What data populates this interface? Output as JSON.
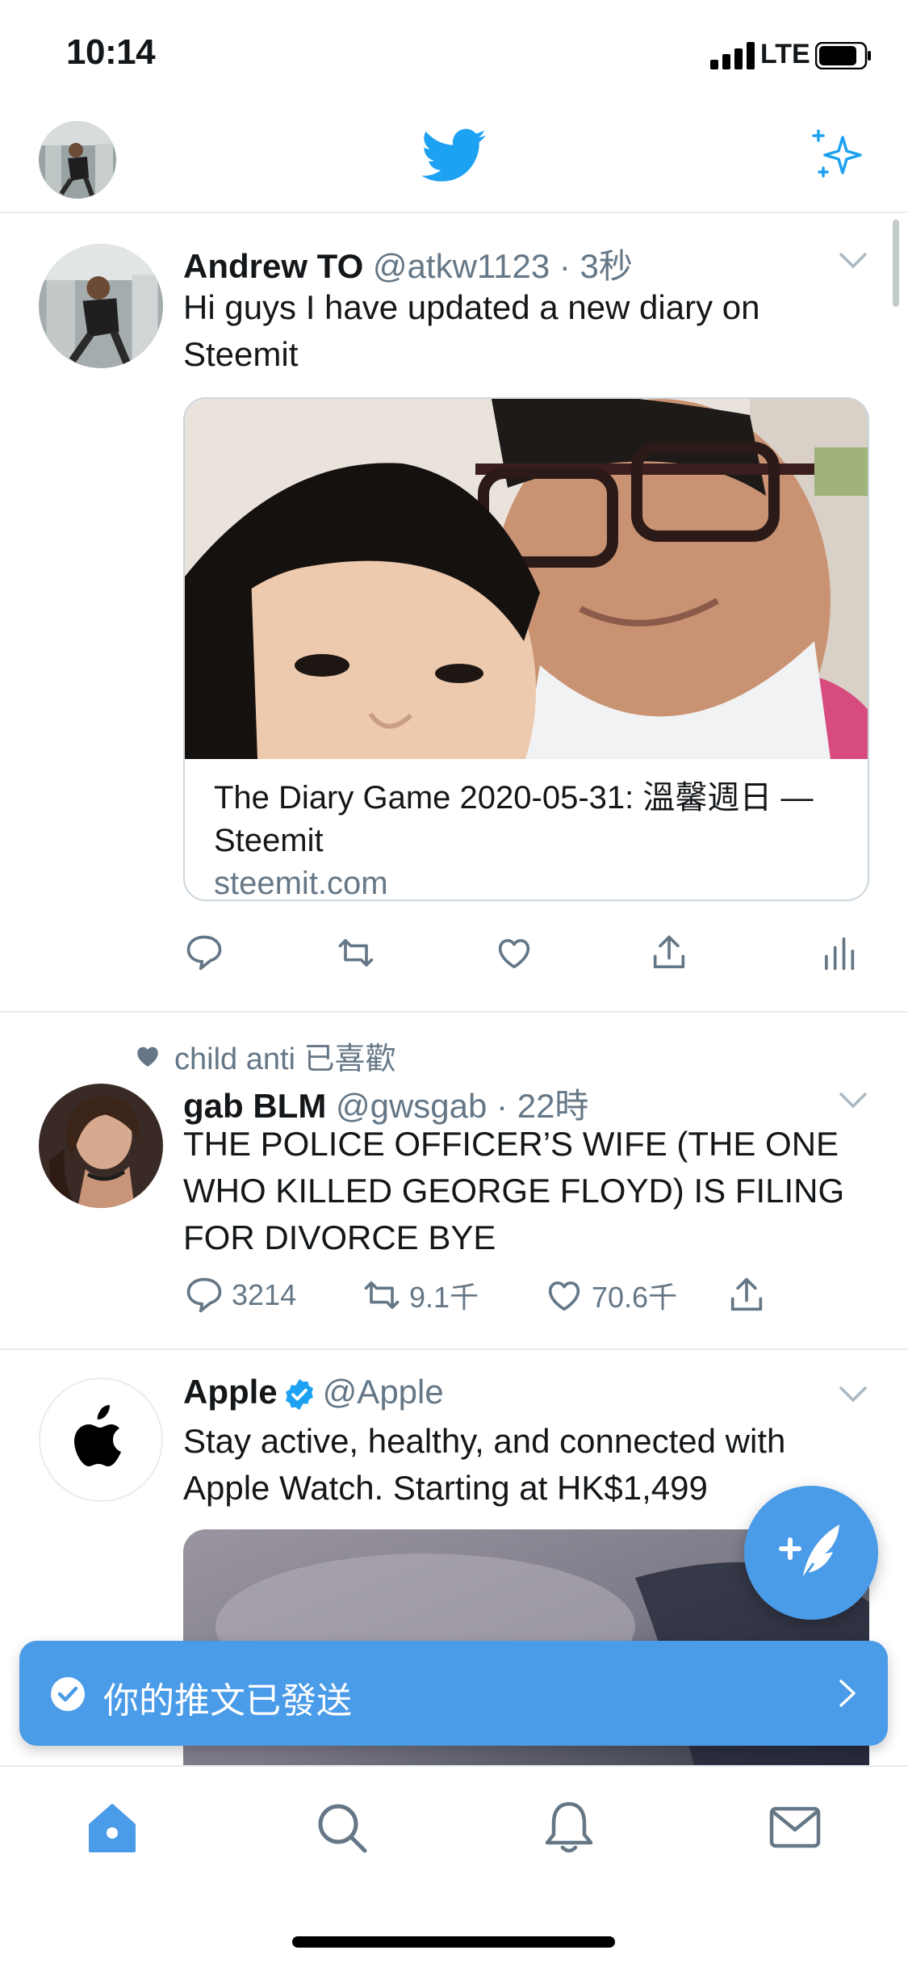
{
  "status_bar": {
    "time": "10:14",
    "network": "LTE"
  },
  "colors": {
    "brand": "#1da1f2",
    "accent": "#4a9be8",
    "secondary_text": "#657786",
    "divider": "#e6ecf0"
  },
  "header": {
    "icons": [
      "profile-avatar",
      "twitter-bird-icon",
      "sparkle-icon"
    ]
  },
  "tweets": [
    {
      "name": "Andrew TO",
      "handle": "@atkw1123 · 3秒",
      "text": "Hi guys I have updated a new diary on Steemit",
      "card": {
        "title": "The Diary Game 2020-05-31: 溫馨週日 — Steemit",
        "domain": "steemit.com"
      }
    },
    {
      "liked_by": "child anti 已喜歡",
      "name": "gab BLM",
      "handle": "@gwsgab · 22時",
      "text": "THE POLICE OFFICER’S WIFE (THE ONE WHO KILLED GEORGE FLOYD) IS FILING FOR DIVORCE BYE",
      "stats": {
        "replies": "3214",
        "retweets": "9.1千",
        "likes": "70.6千"
      }
    },
    {
      "name": "Apple",
      "handle": "@Apple",
      "text": "Stay active, healthy, and connected with Apple Watch. Starting at HK$1,499"
    }
  ],
  "toast": {
    "message": "你的推文已發送"
  },
  "tabbar": {
    "items": [
      "home-icon",
      "search-icon",
      "bell-icon",
      "mail-icon"
    ]
  }
}
